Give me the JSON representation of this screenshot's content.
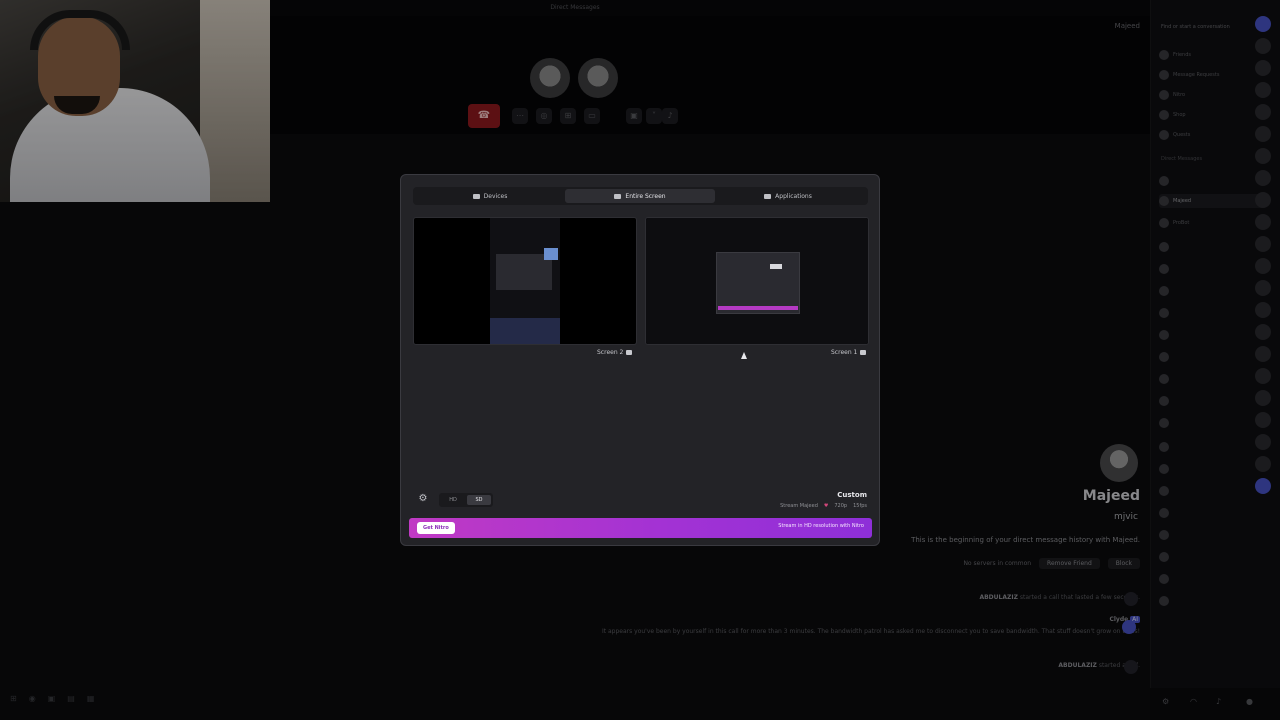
{
  "window": {
    "title": "Direct Messages"
  },
  "call": {
    "hangup_icon": "phone-hangup-icon",
    "controls": [
      "more-icon",
      "activity-icon",
      "grid-icon",
      "screen-share-icon",
      "camera-off-icon",
      "chevron-down-icon",
      "mic-icon"
    ]
  },
  "header": {
    "dm_user": "Majeed"
  },
  "sidebar": {
    "search_placeholder": "Find or start a conversation",
    "nav": [
      {
        "label": "Friends"
      },
      {
        "label": "Message Requests"
      },
      {
        "label": "Nitro"
      },
      {
        "label": "Shop"
      },
      {
        "label": "Quests"
      }
    ],
    "dm_header": "Direct Messages",
    "dms": [
      {
        "label": ""
      },
      {
        "label": "Majeed",
        "selected": true
      },
      {
        "label": "ProBot"
      },
      {
        "label": ""
      },
      {
        "label": ""
      },
      {
        "label": ""
      },
      {
        "label": ""
      },
      {
        "label": ""
      },
      {
        "label": ""
      },
      {
        "label": ""
      },
      {
        "label": ""
      }
    ]
  },
  "dm_intro": {
    "name": "Majeed",
    "username": "mjvic",
    "beginning": "This is the beginning of your direct message history with Majeed.",
    "mutual": "No servers in common",
    "remove_friend": "Remove Friend",
    "block": "Block"
  },
  "messages": [
    {
      "author": "ABDULAZIZ",
      "text": "started a call that lasted a few seconds."
    },
    {
      "author": "Clyde",
      "badge": "AI",
      "text": "It appears you've been by yourself in this call for more than 3 minutes. The bandwidth patrol has asked me to disconnect you to save bandwidth. That stuff doesn't grow on trees!"
    },
    {
      "author": "ABDULAZIZ",
      "text": "started a call."
    }
  ],
  "modal": {
    "tabs": [
      {
        "label": "Applications",
        "icon": "window-icon"
      },
      {
        "label": "Entire Screen",
        "icon": "monitor-icon",
        "active": true
      },
      {
        "label": "Devices",
        "icon": "camera-icon"
      }
    ],
    "screens": [
      {
        "label": "Screen 1"
      },
      {
        "label": "Screen 2"
      }
    ],
    "custom": {
      "title": "Custom",
      "fps": "15fps",
      "resolution": "720p",
      "stream_info": "Stream Majeed"
    },
    "quality": {
      "options": [
        "SD",
        "HD"
      ],
      "active": "SD"
    },
    "nitro": {
      "text": "Stream in HD resolution with Nitro",
      "button": "Get Nitro"
    }
  },
  "colors": {
    "accent": "#c03ac4",
    "danger": "#8e1a1e",
    "blurple": "#4752c4"
  }
}
